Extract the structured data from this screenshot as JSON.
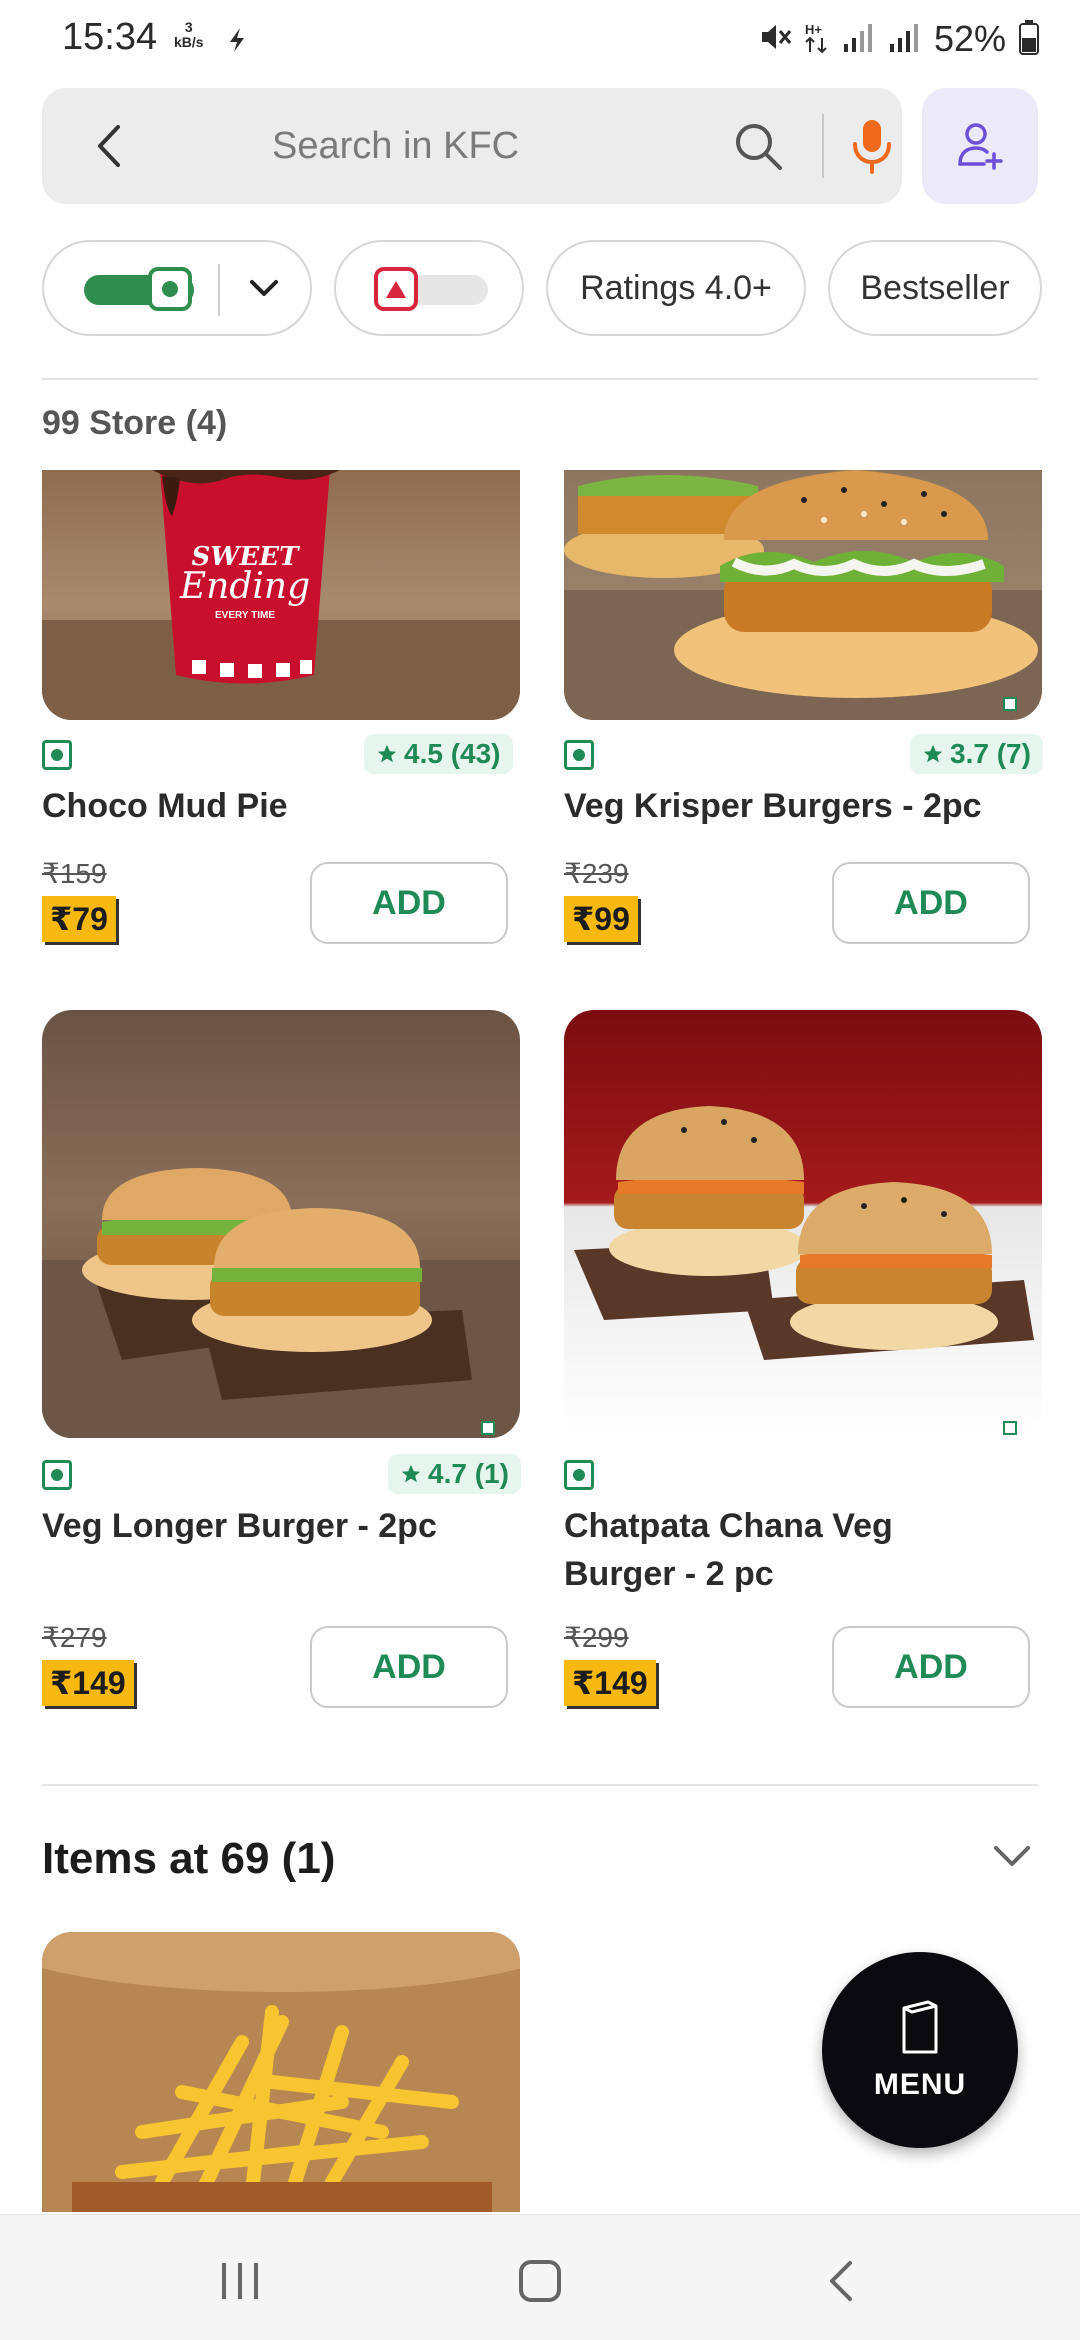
{
  "status_bar": {
    "time": "15:34",
    "net_speed_value": "3",
    "net_speed_unit": "kB/s",
    "battery": "52%"
  },
  "search": {
    "placeholder": "Search in KFC"
  },
  "filters": {
    "ratings_label": "Ratings 4.0+",
    "bestseller_label": "Bestseller"
  },
  "store_section": {
    "title": "99 Store (4)",
    "items": [
      {
        "name": "Choco Mud Pie",
        "rating": "4.5 (43)",
        "old_price": "₹159",
        "price": "₹79",
        "add_label": "ADD"
      },
      {
        "name": "Veg Krisper Burgers - 2pc",
        "rating": "3.7 (7)",
        "old_price": "₹239",
        "price": "₹99",
        "add_label": "ADD"
      },
      {
        "name": "Veg Longer Burger - 2pc",
        "rating": "4.7 (1)",
        "old_price": "₹279",
        "price": "₹149",
        "add_label": "ADD"
      },
      {
        "name_line1": "Chatpata Chana Veg",
        "name_line2": "Burger - 2 pc",
        "old_price": "₹299",
        "price": "₹149",
        "add_label": "ADD"
      }
    ]
  },
  "items_at_69": {
    "title": "Items at 69 (1)"
  },
  "menu_button": {
    "label": "MENU"
  },
  "colors": {
    "accent_green": "#1f8a55",
    "price_tag_yellow": "#f7b80f",
    "mic_orange": "#f06a1d",
    "profile_purple": "#6b4fd8"
  }
}
